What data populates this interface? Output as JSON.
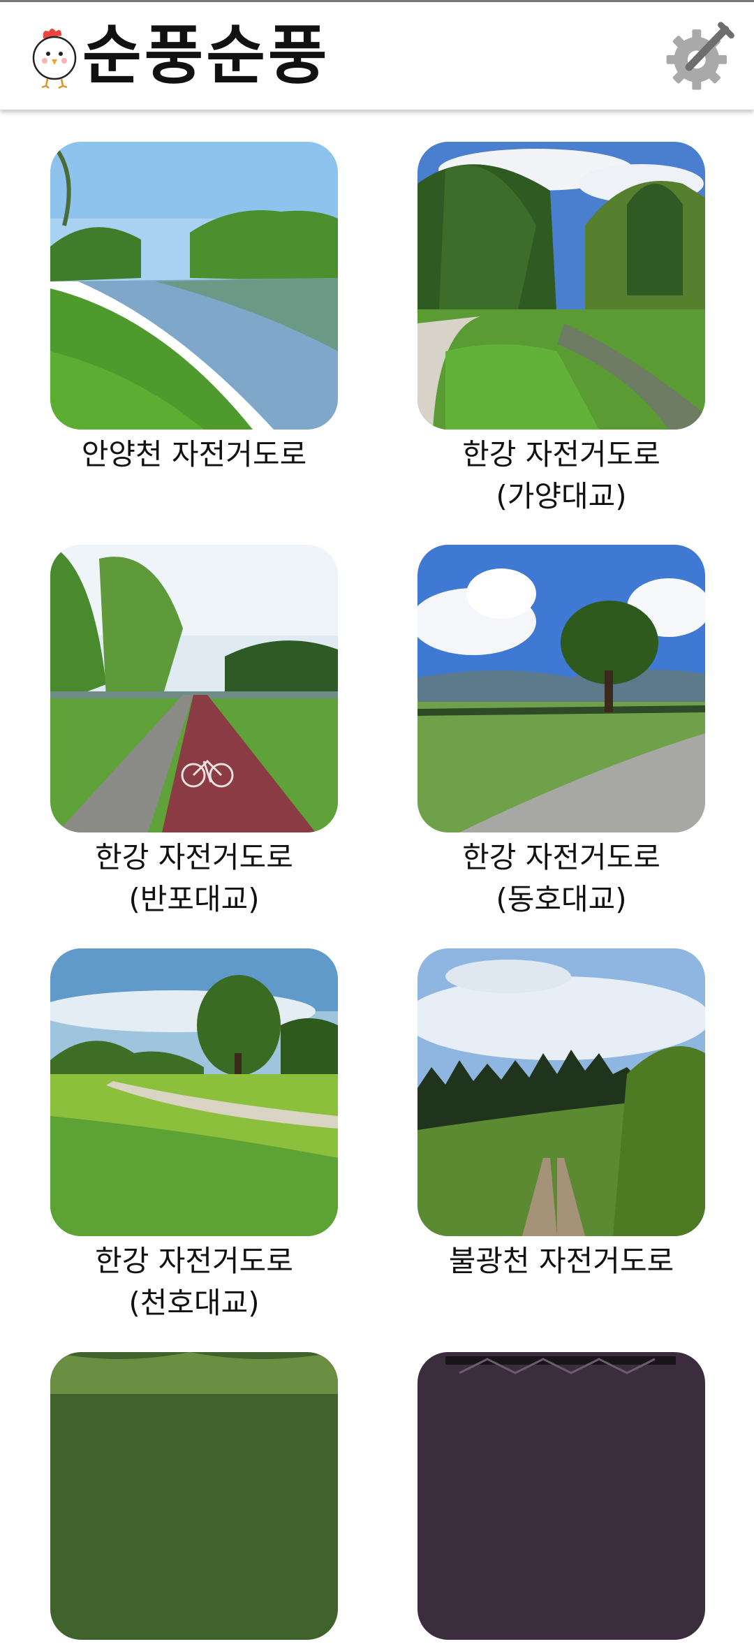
{
  "app": {
    "title": "순풍순풍",
    "icons": {
      "logo": "chick-mascot-icon",
      "settings": "gear-wrench-icon"
    }
  },
  "routes": [
    {
      "line1": "안양천 자전거도로",
      "line2": "",
      "scene": "river-canal"
    },
    {
      "line1": "한강 자전거도로",
      "line2": "(가양대교)",
      "scene": "park-path-stream"
    },
    {
      "line1": "한강 자전거도로",
      "line2": "(반포대교)",
      "scene": "red-bike-lane"
    },
    {
      "line1": "한강 자전거도로",
      "line2": "(동호대교)",
      "scene": "field-tree-road"
    },
    {
      "line1": "한강 자전거도로",
      "line2": "(천호대교)",
      "scene": "meadow-tree-path"
    },
    {
      "line1": "불광천 자전거도로",
      "line2": "",
      "scene": "forest-dirt-road"
    },
    {
      "line1": "",
      "line2": "",
      "scene": "woods-partial"
    },
    {
      "line1": "",
      "line2": "",
      "scene": "bridge-partial"
    }
  ],
  "colors": {
    "header_bg": "#ffffff",
    "text": "#111111",
    "grass": "#4f9a2c",
    "sky": "#6aa8e6"
  }
}
